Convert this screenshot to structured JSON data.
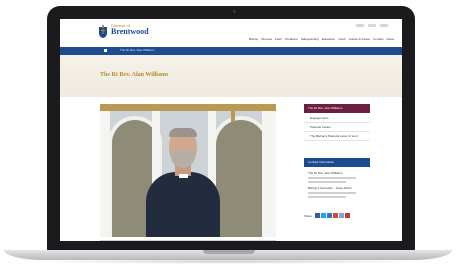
{
  "site": {
    "brand_prefix": "Diocese of",
    "brand_name": "Brentwood",
    "nav": [
      "Bishop",
      "Diocese",
      "Faith",
      "Vocations",
      "Safeguarding",
      "Education",
      "Youth",
      "Justice & Peace",
      "Contact",
      "News"
    ],
    "breadcrumb": "The Rt Rev. Alan Williams"
  },
  "page": {
    "title": "The Rt Rev. Alan Williams"
  },
  "sidebar": {
    "section_title": "The Rt Rev. Alan Williams",
    "links": [
      "Engagements",
      "Pastoral Letters",
      "The Bishop's Pastoral Letter of Lent"
    ],
    "contact_title": "Contact Information",
    "contact_lines": [
      "The Rt Rev. Alan Williams",
      "Bishop's Secretary - Janet Smith"
    ],
    "share_label": "Share"
  },
  "colors": {
    "brand_blue": "#1d4b8f",
    "maroon": "#6d1f3f",
    "gold": "#b48a2f",
    "share": [
      "#3b5998",
      "#1da1f2",
      "#2a7bc1",
      "#d64a3a",
      "#7aa8d9",
      "#c0392b"
    ]
  },
  "icons": {
    "logo": "diocese-crest-icon",
    "home": "home-icon",
    "camera": "webcam-icon"
  }
}
